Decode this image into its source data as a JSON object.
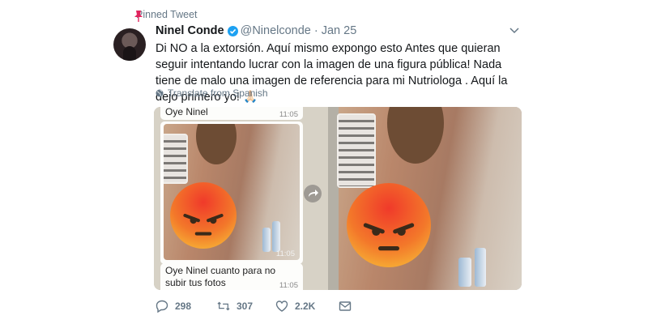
{
  "pinned": {
    "label": "Pinned Tweet"
  },
  "header": {
    "name": "Ninel Conde",
    "handle": "@Ninelconde",
    "separator": "·",
    "date": "Jan 25"
  },
  "tweet": {
    "text": "Di NO a la extorsión. Aquí mismo expongo esto Antes que quieran seguir intentando lucrar con la imagen de una figura pública! Nada tiene de malo una imagen de referencia para mi Nutriologa . Aquí la dejo primero yo! 🙏🏻"
  },
  "translate": {
    "label": "Translate from Spanish"
  },
  "media": {
    "chat": {
      "msg1": "Oye Ninel",
      "msg1_time": "11:05",
      "photo_time": "11:05",
      "msg2": "Oye Ninel cuanto para no subir tus fotos",
      "msg2_time": "11:05"
    }
  },
  "actions": {
    "replies": "298",
    "retweets": "307",
    "likes": "2.2K"
  },
  "icons": {
    "pin": "pin-icon",
    "verified": "verified-badge-icon",
    "caret": "chevron-down-icon",
    "globe": "globe-icon",
    "forward": "share-arrow-icon",
    "reply": "reply-icon",
    "retweet": "retweet-icon",
    "like": "heart-icon",
    "dm": "envelope-icon"
  },
  "colors": {
    "pin": "#e0245e",
    "verified": "#1da1f2",
    "muted": "#657786"
  }
}
